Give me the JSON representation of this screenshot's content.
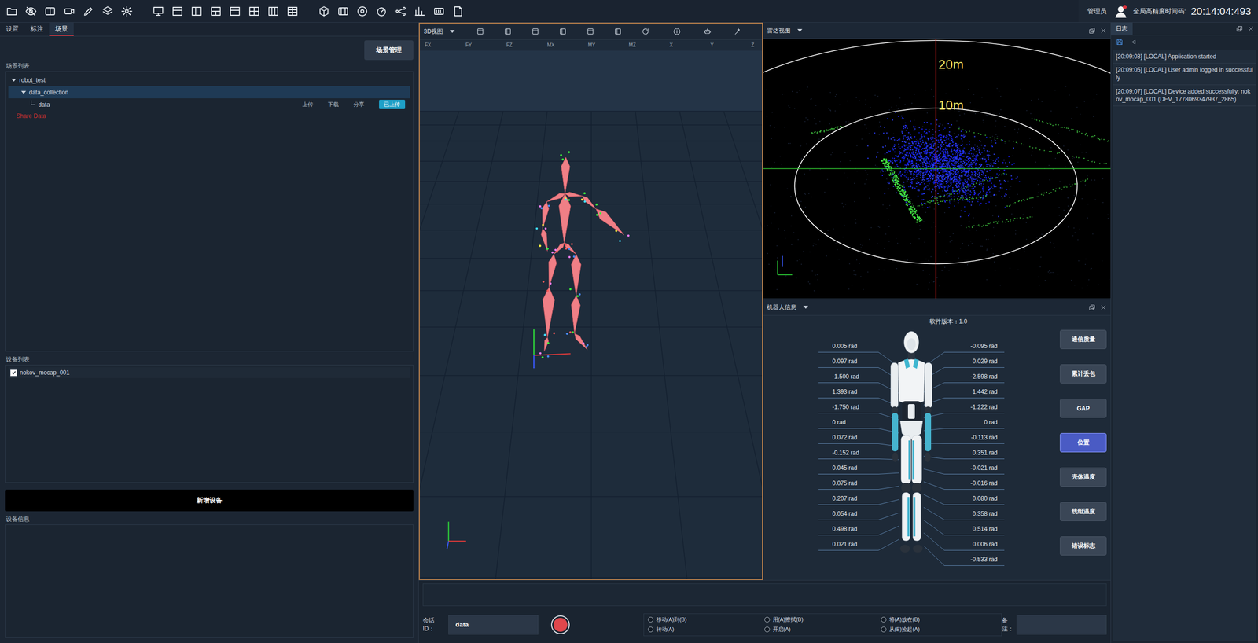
{
  "toolbar": {
    "role": "管理员",
    "timecode_label": "全局高精度时间码:",
    "timecode": "20:14:04:493"
  },
  "left_tabs": [
    {
      "label": "设置",
      "selected": false
    },
    {
      "label": "标注",
      "selected": false
    },
    {
      "label": "场景",
      "selected": true
    }
  ],
  "scene_manager_button": "场景管理",
  "scene_list": {
    "title": "场景列表",
    "nodes": [
      {
        "label": "robot_test",
        "depth": 0,
        "expanded": true,
        "selected": false
      },
      {
        "label": "data_collection",
        "depth": 1,
        "expanded": true,
        "selected": true
      },
      {
        "label": "data",
        "depth": 2,
        "selected": false,
        "actions": [
          "上传",
          "下载",
          "分享"
        ],
        "status": "已上传"
      }
    ],
    "share_link": "Share Data"
  },
  "device_list": {
    "title": "设备列表",
    "items": [
      {
        "name": "nokov_mocap_001",
        "checked": true
      }
    ]
  },
  "add_device_button": "新增设备",
  "device_info": {
    "title": "设备信息"
  },
  "view3d": {
    "title": "3D视图",
    "columns": [
      "FX",
      "FY",
      "FZ",
      "MX",
      "MY",
      "MZ",
      "X",
      "Y",
      "Z"
    ]
  },
  "radar": {
    "title": "雷达视图",
    "range_labels": [
      "20m",
      "10m"
    ]
  },
  "robot_info": {
    "title": "机器人信息",
    "version": "软件版本：1.0",
    "left_joints": [
      "0.005 rad",
      "0.097 rad",
      "-1.500 rad",
      "1.393 rad",
      "-1.750 rad",
      "0 rad",
      "0.072 rad",
      "-0.152 rad",
      "0.045 rad",
      "0.075 rad",
      "0.207 rad",
      "0.054 rad",
      "0.498 rad",
      "0.021 rad"
    ],
    "right_joints": [
      "-0.095 rad",
      "0.029 rad",
      "-2.598 rad",
      "1.442 rad",
      "-1.222 rad",
      "0 rad",
      "-0.113 rad",
      "0.351 rad",
      "-0.021 rad",
      "-0.016 rad",
      "0.080 rad",
      "0.358 rad",
      "0.514 rad",
      "0.006 rad",
      "-0.533 rad"
    ],
    "buttons": [
      {
        "label": "通信质量",
        "selected": false
      },
      {
        "label": "累计丢包",
        "selected": false
      },
      {
        "label": "GAP",
        "selected": false
      },
      {
        "label": "位置",
        "selected": true
      },
      {
        "label": "壳体温度",
        "selected": false
      },
      {
        "label": "线组温度",
        "selected": false
      },
      {
        "label": "错误标志",
        "selected": false
      }
    ]
  },
  "log": {
    "tab": "日志",
    "entries": [
      "[20:09:03] [LOCAL] Application started",
      "[20:09:05] [LOCAL] User admin logged in successfully",
      "[20:09:07] [LOCAL] Device added successfully: nokov_mocap_001 (DEV_1778069347937_2865)"
    ]
  },
  "bottom_bar": {
    "session_label": "会话ID：",
    "session_id": "data",
    "actions": [
      {
        "label": "移动(A)到(B)",
        "selected": false
      },
      {
        "label": "转动(A)",
        "selected": false
      },
      {
        "label": "用(A)擦拭(B)",
        "selected": false
      },
      {
        "label": "开启(A)",
        "selected": false
      },
      {
        "label": "将(A)放在(B)",
        "selected": false
      },
      {
        "label": "从(B)捡起(A)",
        "selected": false
      }
    ],
    "note_label": "备注：",
    "note": ""
  }
}
